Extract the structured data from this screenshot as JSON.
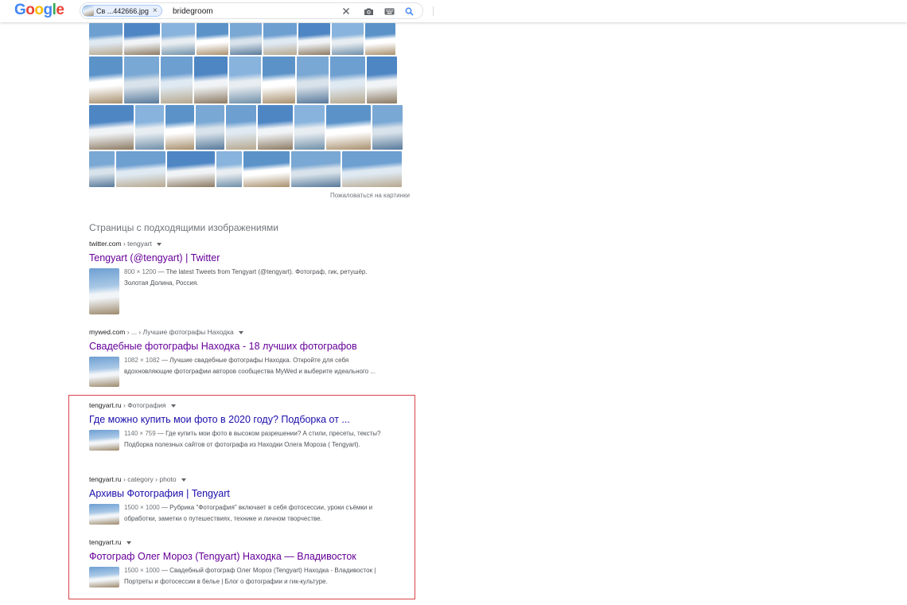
{
  "header": {
    "logo": "Google",
    "chip_label": "Св ...442666.jpg",
    "query": "bridegroom",
    "icons": [
      "close-icon",
      "camera-icon",
      "keyboard-icon",
      "search-icon"
    ]
  },
  "colors": {
    "visited_link": "#660099",
    "link": "#1a0dab",
    "highlight_border": "#d9434a"
  },
  "image_grid": {
    "rows": [
      [
        42,
        45,
        42,
        40,
        40,
        42,
        40,
        40,
        38
      ],
      [
        42,
        44,
        40,
        42,
        40,
        41,
        40,
        44,
        38
      ],
      [
        56,
        36,
        36,
        36,
        38,
        44,
        38,
        56,
        38
      ],
      [
        32,
        62,
        60,
        32,
        58,
        62,
        75
      ]
    ],
    "report_link": "Пожаловаться на картинки"
  },
  "section_title": "Страницы с подходящими изображениями",
  "results": [
    {
      "site": "twitter.com",
      "path": " › tengyart",
      "title": "Tengyart (@tengyart) | Twitter",
      "visited": true,
      "dims": "800 × 1200",
      "snippet": " — The latest Tweets from Tengyart (@tengyart). Фотограф, гик, ретушёр. Золотая Долина, Россия."
    },
    {
      "site": "mywed.com",
      "path": " › ... › Лучшие фотографы Находка",
      "title": "Свадебные фотографы Находка - 18 лучших фотографов",
      "visited": true,
      "dims": "1082 × 1082",
      "snippet": " — Лучшие свадебные фотографы Находка. Откройте для себя вдохновляющие фотографии авторов сообщества MyWed и выберите идеального ..."
    },
    {
      "site": "tengyart.ru",
      "path": " › Фотография",
      "title": "Где можно купить мои фото в 2020 году? Подборка от ...",
      "visited": false,
      "dims": "1140 × 759",
      "snippet": " — Где купить мои фото в высоком разрешении? А стили, пресеты, тексты? Подборка полезных сайтов от фотографа из Находки Олега Мороза ( Tengyart)."
    },
    {
      "site": "tengyart.ru",
      "path": " › category › photo",
      "title": "Архивы Фотография | Tengyart",
      "visited": false,
      "dims": "1500 × 1000",
      "snippet": " — Рубрика \"Фотография\" включает в себя фотосессии, уроки съёмки и обработки, заметки о путешествиях, технике и личном творчестве."
    },
    {
      "site": "tengyart.ru",
      "path": "",
      "title": "Фотограф Олег Мороз (Tengyart) Находка — Владивосток",
      "visited": true,
      "dims": "1500 × 1000",
      "snippet": " — Свадебный фотограф Олег Мороз (Tengyart) Находка - Владивосток | Портреты и фотосессии в белье | Блог о фотографии и гик-культуре."
    }
  ]
}
